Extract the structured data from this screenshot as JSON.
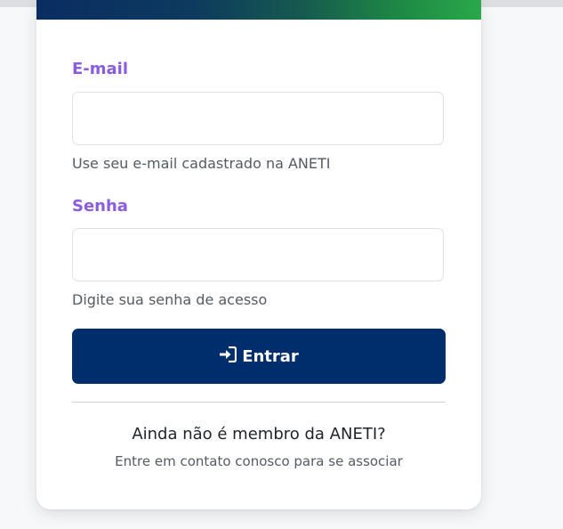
{
  "form": {
    "email": {
      "label": "E-mail",
      "value": "",
      "placeholder": "",
      "help": "Use seu e-mail cadastrado na ANETI"
    },
    "password": {
      "label": "Senha",
      "value": "",
      "placeholder": "",
      "help": "Digite sua senha de acesso"
    },
    "submit_label": "Entrar",
    "submit_icon": "sign-in-icon"
  },
  "footer": {
    "question": "Ainda não é membro da ANETI?",
    "contact": "Entre em contato conosco para se associar"
  },
  "colors": {
    "label": "#8a5ce0",
    "button": "#002d6b",
    "header_gradient_start": "#0a2d62",
    "header_gradient_end": "#2aa84a"
  }
}
